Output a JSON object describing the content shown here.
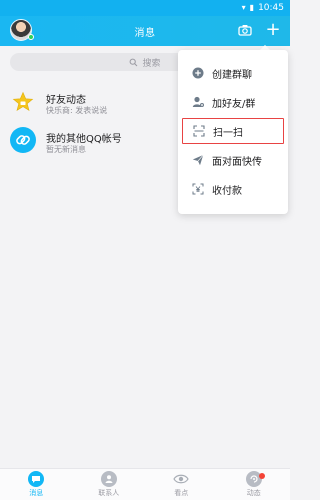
{
  "status_bar": {
    "time": "10:45",
    "icons": [
      "wifi-icon",
      "battery-icon"
    ]
  },
  "header": {
    "title": "消息",
    "icons": [
      "avatar",
      "camera-icon",
      "plus-icon"
    ]
  },
  "search": {
    "placeholder": "搜索"
  },
  "conversations": [
    {
      "title": "好友动态",
      "subtitle": "快乐商: 发表说说",
      "icon": "star-icon"
    },
    {
      "title": "我的其他QQ帐号",
      "subtitle": "暂无新消息",
      "icon": "link-icon"
    }
  ],
  "menu": {
    "items": [
      {
        "label": "创建群聊",
        "icon": "add-group-icon"
      },
      {
        "label": "加好友/群",
        "icon": "add-friend-icon"
      },
      {
        "label": "扫一扫",
        "icon": "scan-icon",
        "highlighted": true
      },
      {
        "label": "面对面快传",
        "icon": "send-icon"
      },
      {
        "label": "收付款",
        "icon": "payment-icon"
      }
    ]
  },
  "bottom_nav": {
    "tabs": [
      {
        "label": "消息",
        "icon": "message-icon",
        "active": true
      },
      {
        "label": "联系人",
        "icon": "contacts-icon"
      },
      {
        "label": "看点",
        "icon": "eye-icon"
      },
      {
        "label": "动态",
        "icon": "dynamics-icon",
        "badge": true
      }
    ]
  },
  "colors": {
    "brand_blue": "#12b7f5",
    "highlight_red": "#e84343",
    "badge_red": "#f44336"
  }
}
